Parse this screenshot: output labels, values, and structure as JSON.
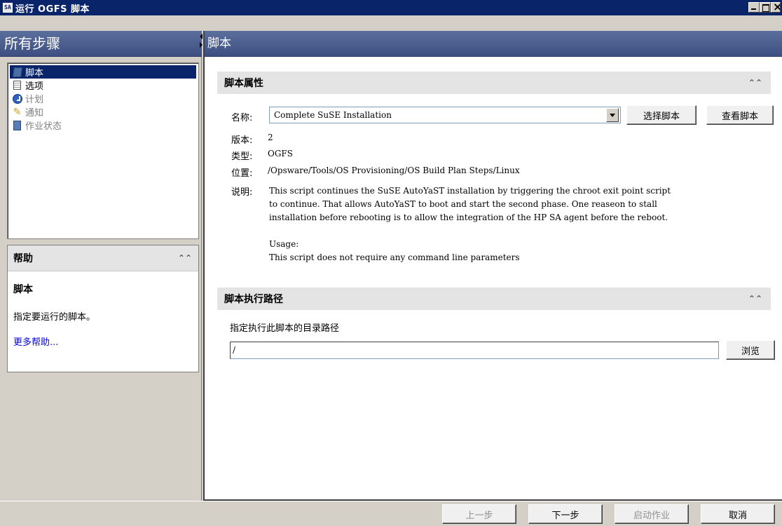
{
  "window": {
    "app_icon": "SA",
    "title": "运行 OGFS 脚本"
  },
  "left": {
    "header": "所有步骤",
    "steps": [
      {
        "label": "脚本",
        "icon": "script-icon",
        "selected": true,
        "enabled": true
      },
      {
        "label": "选项",
        "icon": "options-icon",
        "selected": false,
        "enabled": true
      },
      {
        "label": "计划",
        "icon": "schedule-icon",
        "selected": false,
        "enabled": false
      },
      {
        "label": "通知",
        "icon": "notification-icon",
        "selected": false,
        "enabled": false
      },
      {
        "label": "作业状态",
        "icon": "job-status-icon",
        "selected": false,
        "enabled": false
      }
    ],
    "help": {
      "header": "帮助",
      "collapse_glyph": "≈",
      "subtitle": "脚本",
      "text": "指定要运行的脚本。",
      "link": "更多帮助..."
    }
  },
  "right": {
    "header": "脚本",
    "properties": {
      "header": "脚本属性",
      "name_label": "名称:",
      "name_value": "Complete SuSE Installation",
      "select_button": "选择脚本",
      "view_button": "查看脚本",
      "version_label": "版本:",
      "version_value": "2",
      "type_label": "类型:",
      "type_value": "OGFS",
      "location_label": "位置:",
      "location_value": "/Opsware/Tools/OS Provisioning/OS Build Plan Steps/Linux",
      "description_label": "说明:",
      "description_value": "This script continues the SuSE AutoYaST installation by triggering the chroot exit point script\nto continue. That allows AutoYaST to boot and start the second phase. One reaseon to stall\ninstallation before rebooting is to allow the integration of the HP SA agent before the reboot.\n\nUsage:\nThis script does not require any command line parameters"
    },
    "exec_path": {
      "header": "脚本执行路径",
      "prompt": "指定执行此脚本的目录路径",
      "value": "/",
      "browse_button": "浏览"
    }
  },
  "footer": {
    "back": "上一步",
    "next": "下一步",
    "start": "启动作业",
    "cancel": "取消"
  },
  "collapse_glyph": "≈"
}
